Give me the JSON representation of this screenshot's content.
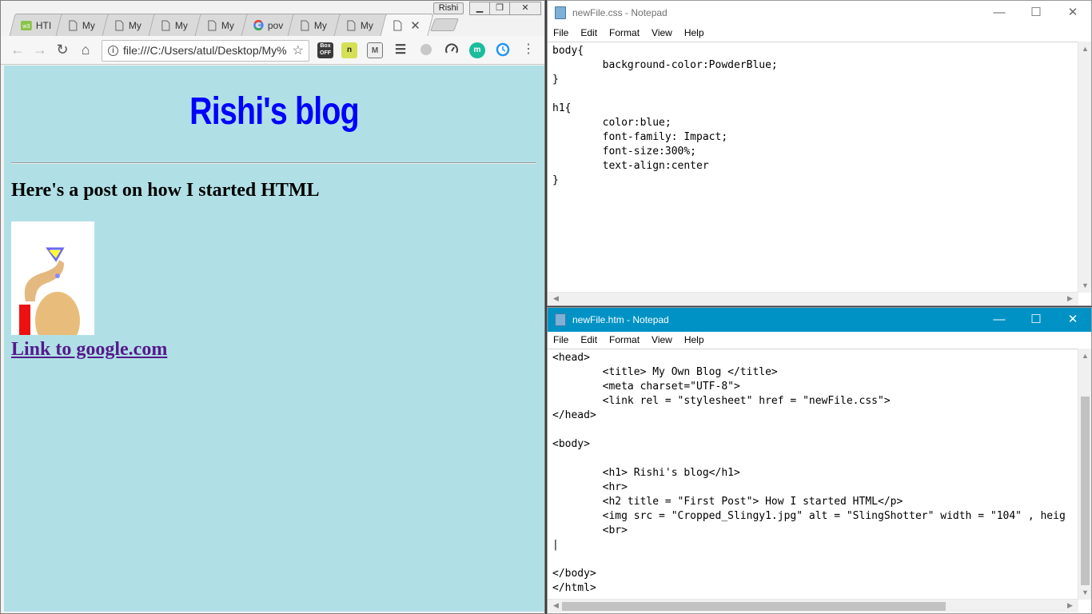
{
  "browser": {
    "tabs": [
      {
        "label": "HTI",
        "icon": "w3schools-icon"
      },
      {
        "label": "My",
        "icon": "page-icon"
      },
      {
        "label": "My",
        "icon": "page-icon"
      },
      {
        "label": "My",
        "icon": "page-icon"
      },
      {
        "label": "My",
        "icon": "page-icon"
      },
      {
        "label": "pov",
        "icon": "google-icon"
      },
      {
        "label": "My",
        "icon": "page-icon"
      },
      {
        "label": "My",
        "icon": "page-icon"
      },
      {
        "label": "",
        "icon": "page-icon",
        "active": true
      }
    ],
    "profile_name": "Rishi",
    "address": "file:///C:/Users/atul/Desktop/My%",
    "extensions": [
      "box-off",
      "n",
      "m",
      "list",
      "gray-circle",
      "speedometer",
      "m-teal",
      "clock"
    ],
    "extension_labels": {
      "box": "Box",
      "off": "OFF",
      "n": "n",
      "m": "M",
      "m_teal": "m"
    }
  },
  "page": {
    "h1": "Rishi's blog",
    "h2": "Here's a post on how I started HTML",
    "link": "Link to google.com",
    "background": "#b0e0e6",
    "h1_color": "#0000ff",
    "link_color": "#551a8b"
  },
  "notepad_css": {
    "title": "newFile.css - Notepad",
    "menu": [
      "File",
      "Edit",
      "Format",
      "View",
      "Help"
    ],
    "content": "body{\n        background-color:PowderBlue;\n}\n\nh1{\n        color:blue;\n        font-family: Impact;\n        font-size:300%;\n        text-align:center\n}"
  },
  "notepad_htm": {
    "title": "newFile.htm - Notepad",
    "menu": [
      "File",
      "Edit",
      "Format",
      "View",
      "Help"
    ],
    "content": "<head>\n        <title> My Own Blog </title>\n        <meta charset=\"UTF-8\">\n        <link rel = \"stylesheet\" href = \"newFile.css\">\n</head>\n\n<body>\n\n        <h1> Rishi's blog</h1>\n        <hr>\n        <h2 title = \"First Post\"> How I started HTML</p>\n        <img src = \"Cropped_Slingy1.jpg\" alt = \"SlingShotter\" width = \"104\" , heig\n        <br>\n|\n\n</body>\n</html>"
  },
  "colors": {
    "titlebar_active": "#0092c5"
  }
}
